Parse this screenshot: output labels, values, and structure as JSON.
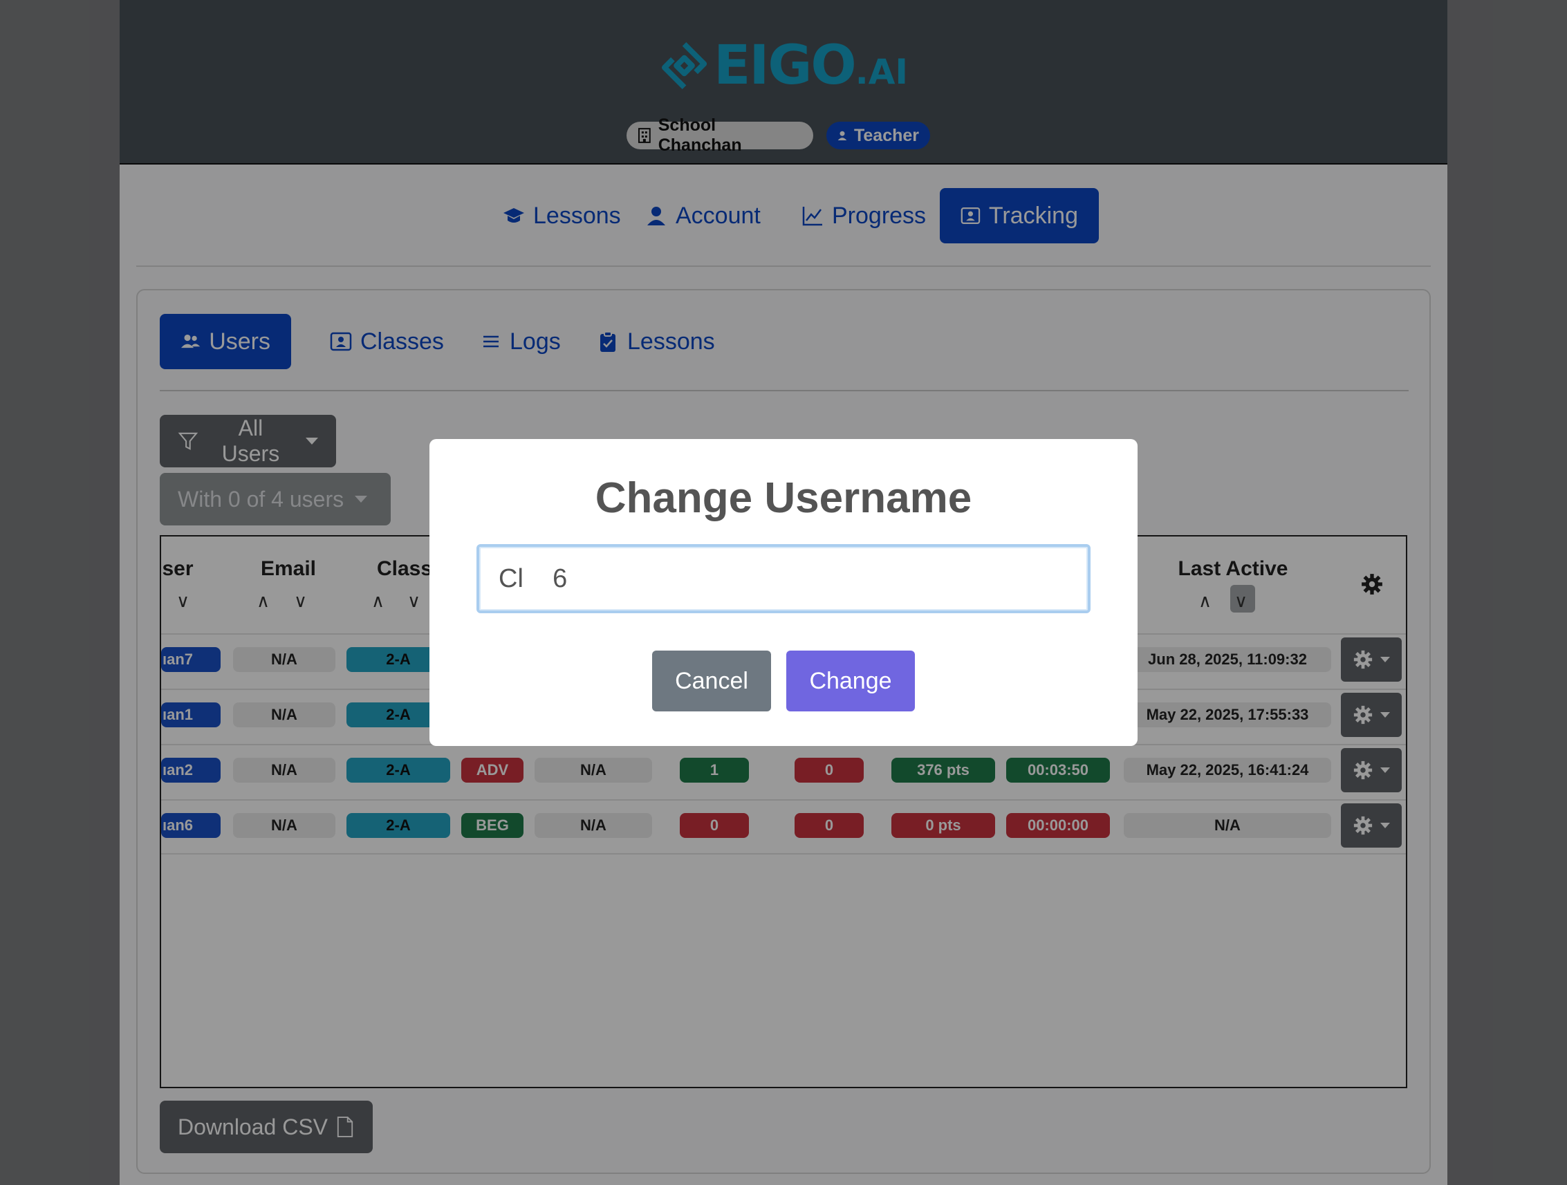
{
  "header": {
    "logo_text": "EIGO",
    "logo_suffix": ".AI",
    "school_label": "School Chanchan",
    "role_label": "Teacher",
    "logo_color": "#17a2c8"
  },
  "main_nav": [
    {
      "label": "Lessons",
      "icon": "graduation-cap-icon",
      "active": false
    },
    {
      "label": "Account",
      "icon": "user-icon",
      "active": false
    },
    {
      "label": "Progress",
      "icon": "chart-line-icon",
      "active": false
    },
    {
      "label": "Tracking",
      "icon": "person-id-icon",
      "active": true
    }
  ],
  "sub_nav": [
    {
      "label": "Users",
      "icon": "users-icon",
      "active": true
    },
    {
      "label": "Classes",
      "icon": "person-frame-icon",
      "active": false
    },
    {
      "label": "Logs",
      "icon": "list-icon",
      "active": false
    },
    {
      "label": "Lessons",
      "icon": "clipboard-check-icon",
      "active": false
    }
  ],
  "filters": {
    "all_users": "All Users",
    "with_users": "With 0 of 4 users"
  },
  "table": {
    "columns": {
      "user": "ser",
      "email": "Email",
      "class": "Class",
      "last_active": "Last Active"
    },
    "rows": [
      {
        "user": "ıan7",
        "email": "N/A",
        "class": "2-A",
        "level": "",
        "col5": "",
        "col6": "",
        "col7": "",
        "points": "",
        "time": "",
        "last_active": "Jun 28, 2025, 11:09:32"
      },
      {
        "user": "ıan1",
        "email": "N/A",
        "class": "2-A",
        "level": "",
        "col5": "",
        "col6": "",
        "col7": "",
        "points": "",
        "time": "",
        "last_active": "May 22, 2025, 17:55:33"
      },
      {
        "user": "ıan2",
        "email": "N/A",
        "class": "2-A",
        "level": "ADV",
        "col5": "N/A",
        "col6": "1",
        "col7": "0",
        "points": "376 pts",
        "time": "00:03:50",
        "last_active": "May 22, 2025, 16:41:24"
      },
      {
        "user": "ıan6",
        "email": "N/A",
        "class": "2-A",
        "level": "BEG",
        "col5": "N/A",
        "col6": "0",
        "col7": "0",
        "points": "0 pts",
        "time": "00:00:00",
        "last_active": "N/A"
      }
    ]
  },
  "download_csv": "Download CSV",
  "modal": {
    "title": "Change Username",
    "input_value": "Cl    6",
    "cancel_label": "Cancel",
    "change_label": "Change"
  }
}
